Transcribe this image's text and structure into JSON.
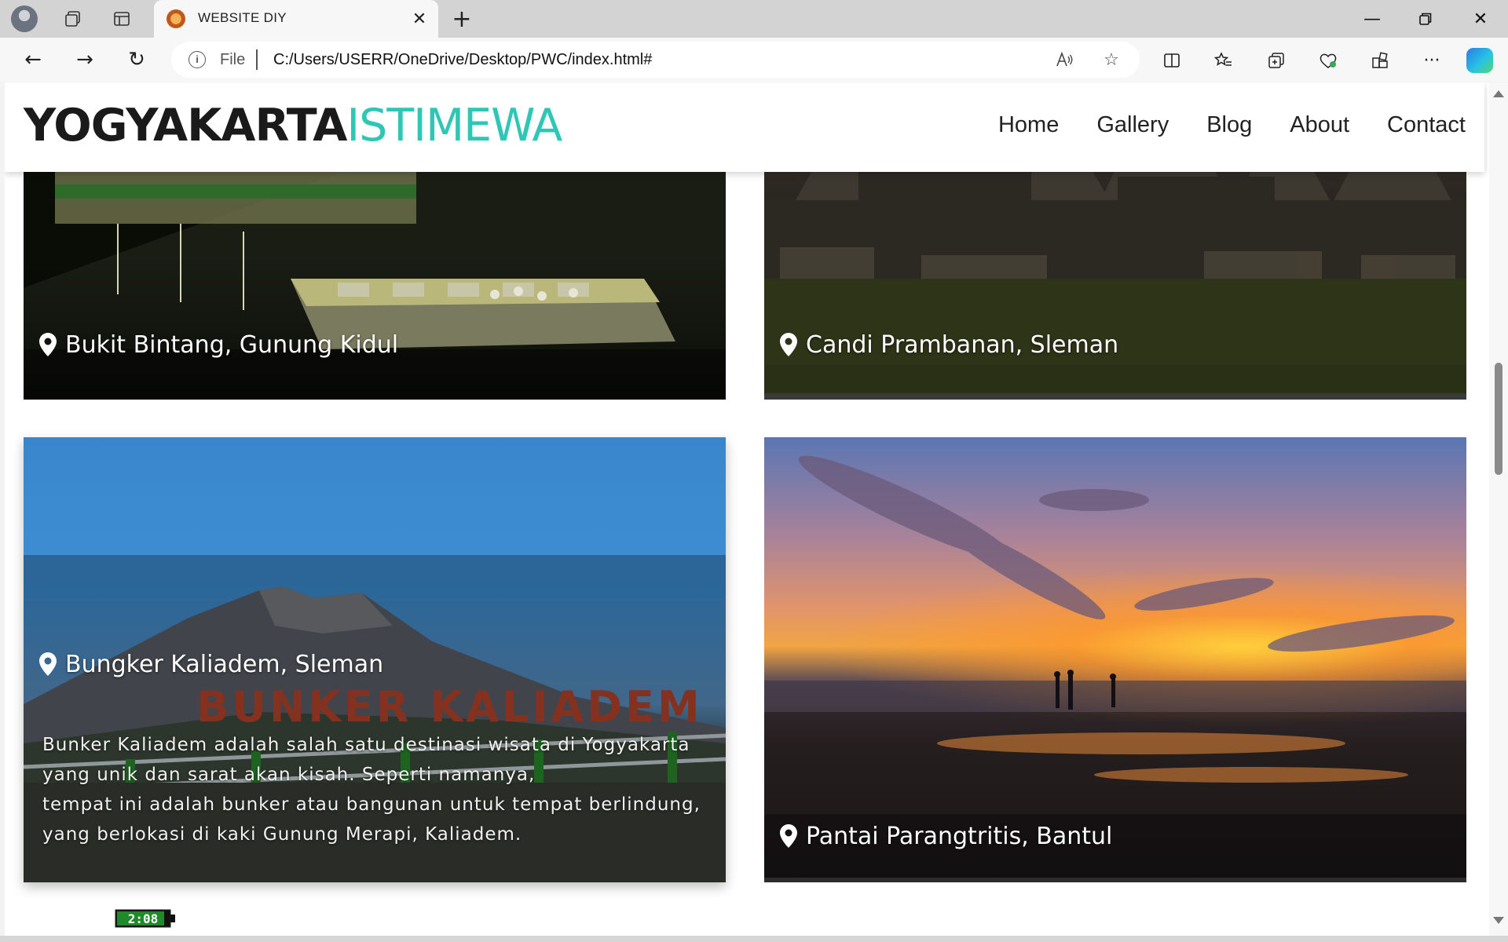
{
  "browser": {
    "tab_title": "WEBSITE DIY",
    "address_scheme_label": "File",
    "address_url": "C:/Users/USERR/OneDrive/Desktop/PWC/index.html#"
  },
  "site": {
    "logo_primary": "YOGYAKARTA",
    "logo_secondary": "ISTIMEWA",
    "nav": [
      "Home",
      "Gallery",
      "Blog",
      "About",
      "Contact"
    ]
  },
  "cards": [
    {
      "title": "Bukit Bintang, Gunung Kidul"
    },
    {
      "title": "Candi Prambanan, Sleman"
    },
    {
      "title": "Bungker Kaliadem, Sleman",
      "sign_text": "BUNKER KALIADEM",
      "description_lines": [
        "Bunker Kaliadem adalah salah satu destinasi wisata di Yogyakarta",
        "yang unik dan sarat akan kisah. Seperti namanya,",
        "tempat ini adalah bunker atau bangunan untuk tempat berlindung,",
        "yang berlokasi di kaki Gunung Merapi, Kaliadem."
      ]
    },
    {
      "title": "Pantai Parangtritis, Bantul"
    }
  ],
  "overlay": {
    "battery_time": "2:08"
  },
  "colors": {
    "accent": "#2ec7b6",
    "logo_dark": "#1a1a1a"
  }
}
